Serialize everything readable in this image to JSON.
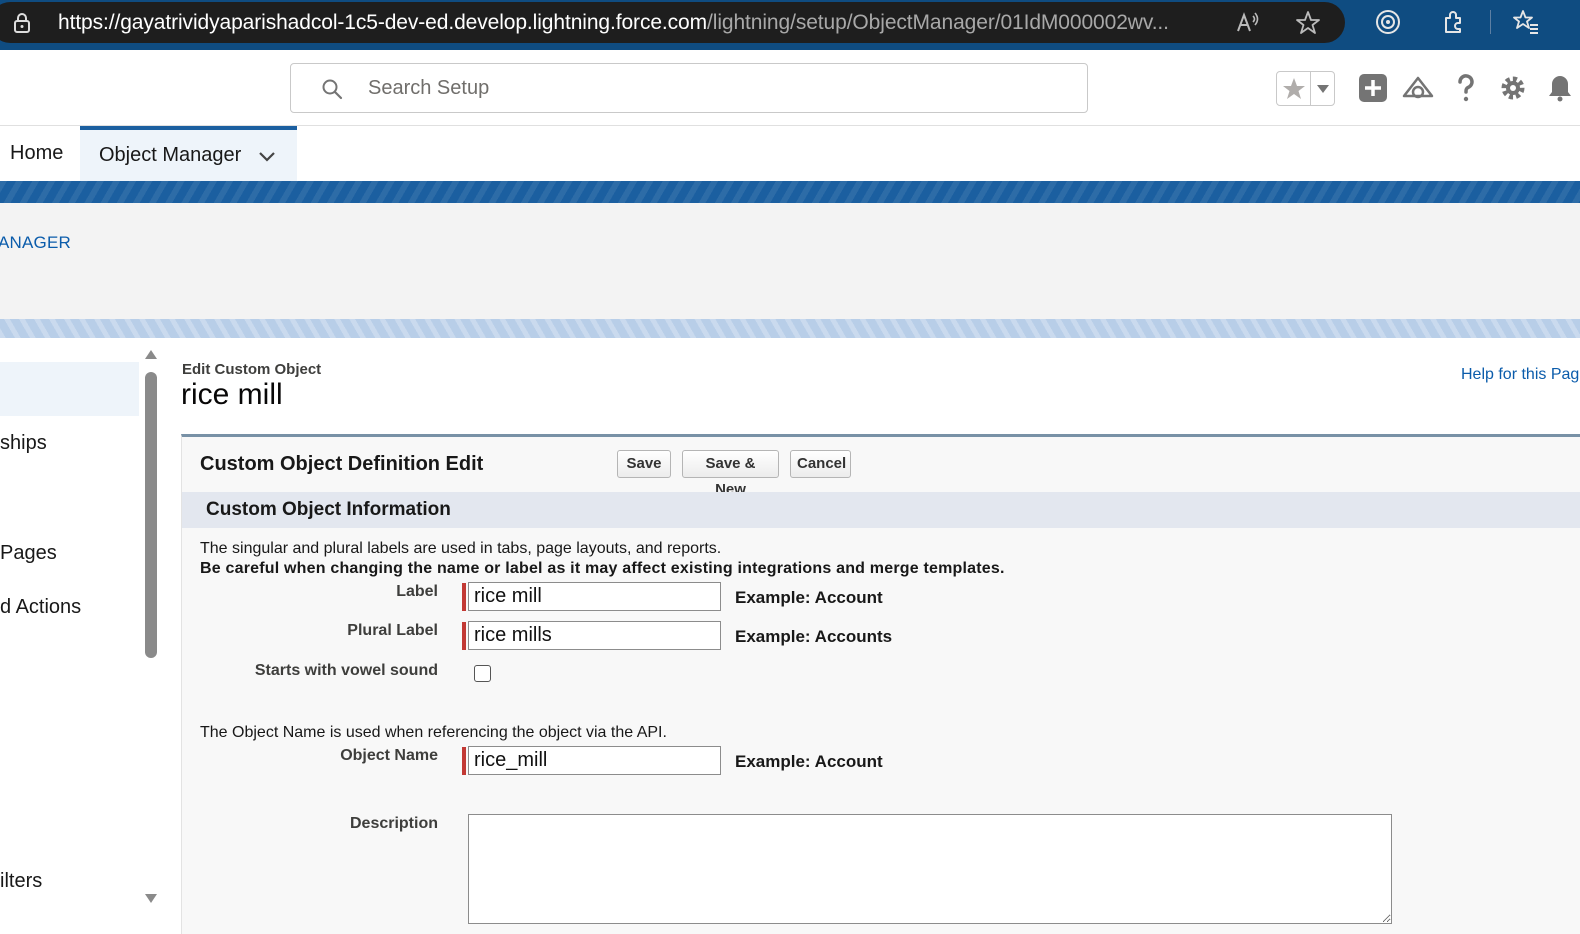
{
  "browser": {
    "url_host": "https://gayatrividyaparishadcol-1c5-dev-ed.develop.lightning.force.com",
    "url_path": "/lightning/setup/ObjectManager/01IdM000002wv..."
  },
  "header": {
    "search_placeholder": "Search Setup"
  },
  "nav": {
    "home_label": "Home",
    "object_manager_label": "Object Manager"
  },
  "breadcrumb": "ANAGER",
  "sidebar": {
    "items": [
      {
        "label": "ships"
      },
      {
        "label": " Pages"
      },
      {
        "label": "d Actions"
      },
      {
        "label": "ilters"
      }
    ]
  },
  "page": {
    "kicker": "Edit Custom Object",
    "title": "rice mill",
    "help_link": "Help for this Pag"
  },
  "form": {
    "block_title": "Custom Object Definition Edit",
    "buttons": {
      "save": "Save",
      "save_new": "Save & New",
      "cancel": "Cancel"
    },
    "section_title": "Custom Object Information",
    "info_line_1": "The singular and plural labels are used in tabs, page layouts, and reports.",
    "info_line_2": "Be careful when changing the name or label as it may affect existing integrations and merge templates.",
    "label_field": {
      "label": "Label",
      "value": "rice mill",
      "example": "Example:  Account"
    },
    "plural_field": {
      "label": "Plural Label",
      "value": "rice mills",
      "example": "Example:  Accounts"
    },
    "vowel_field": {
      "label": "Starts with vowel sound",
      "checked": false
    },
    "api_info": "The Object Name is used when referencing the object via the API.",
    "name_field": {
      "label": "Object Name",
      "value": "rice_mill",
      "example": "Example:  Account"
    },
    "description_field": {
      "label": "Description",
      "value": ""
    }
  },
  "colors": {
    "brand_blue": "#1b5fa0",
    "link_blue": "#0b5cab",
    "required_red": "#c23934"
  }
}
